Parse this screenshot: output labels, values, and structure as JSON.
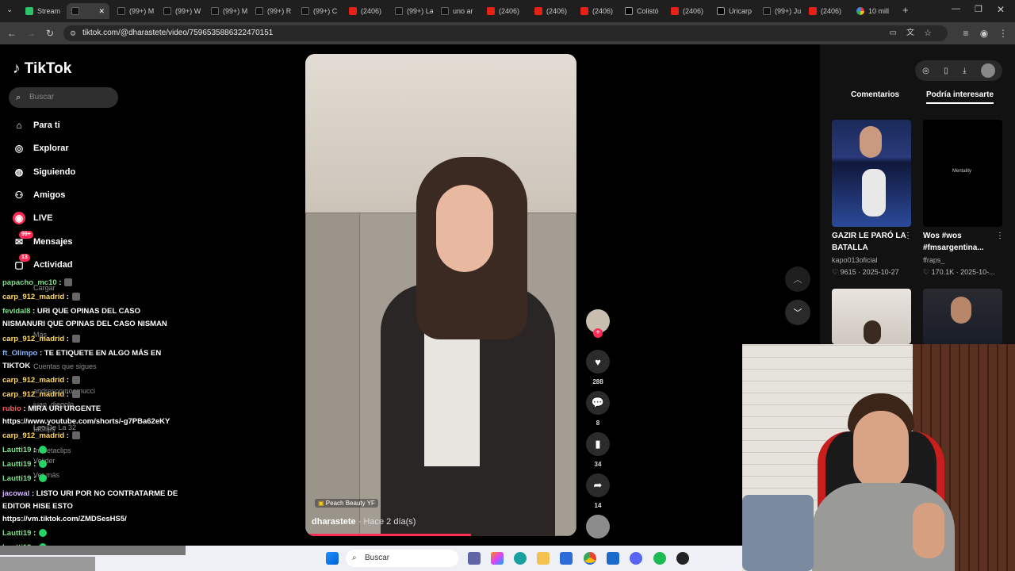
{
  "browser": {
    "tabs": [
      {
        "label": "Stream",
        "icon": "green-icon"
      },
      {
        "label": "",
        "icon": "tiktok-icon",
        "active": true
      },
      {
        "label": "(99+) M",
        "icon": "tiktok-icon"
      },
      {
        "label": "(99+) W",
        "icon": "tiktok-icon"
      },
      {
        "label": "(99+) M",
        "icon": "tiktok-icon"
      },
      {
        "label": "(99+) R",
        "icon": "tiktok-icon"
      },
      {
        "label": "(99+) C",
        "icon": "tiktok-icon"
      },
      {
        "label": "(2406)",
        "icon": "youtube-icon"
      },
      {
        "label": "(99+) La",
        "icon": "tiktok-icon"
      },
      {
        "label": "uno ar",
        "icon": "tiktok-icon"
      },
      {
        "label": "(2406)",
        "icon": "youtube-icon"
      },
      {
        "label": "(2406)",
        "icon": "youtube-icon"
      },
      {
        "label": "(2406)",
        "icon": "youtube-icon"
      },
      {
        "label": "Colistó",
        "icon": "x-icon"
      },
      {
        "label": "(2406)",
        "icon": "youtube-icon"
      },
      {
        "label": "Uricarp",
        "icon": "x-icon"
      },
      {
        "label": "(99+) Ju",
        "icon": "tiktok-icon"
      },
      {
        "label": "(2406)",
        "icon": "youtube-icon"
      },
      {
        "label": "10 mill",
        "icon": "google-icon"
      }
    ],
    "url": "tiktok.com/@dharastete/video/7596535886322470151"
  },
  "sidebar": {
    "logo": "TikTok",
    "search_placeholder": "Buscar",
    "items": [
      {
        "label": "Para ti",
        "icon": "home-icon"
      },
      {
        "label": "Explorar",
        "icon": "compass-icon"
      },
      {
        "label": "Siguiendo",
        "icon": "following-icon"
      },
      {
        "label": "Amigos",
        "icon": "friends-icon"
      },
      {
        "label": "LIVE",
        "icon": "live-icon"
      },
      {
        "label": "Mensajes",
        "icon": "messages-icon",
        "badge": "99+"
      },
      {
        "label": "Actividad",
        "icon": "activity-icon",
        "badge": "13"
      }
    ],
    "ghost_items": [
      "Cargar",
      "Más",
      "Cuentas que sigues",
      "andrescomoamucci",
      "juan_diegolo",
      "Leo De La 32",
      "taClips",
      "macetaclips",
      "Veijder",
      "Ver más"
    ]
  },
  "video": {
    "music_tag": "Peach Beauty YF",
    "author": "dharastete",
    "time": "· Hace 2 día(s)",
    "progress": 0.61
  },
  "actions": {
    "likes": "288",
    "comments": "8",
    "saves": "34",
    "shares": "14"
  },
  "right_panel": {
    "tabs": [
      "Comentarios",
      "Podría interesarte"
    ],
    "cards": [
      {
        "caption": "GAZIR LE PARÓ LA BATALLA",
        "user": "kapo013oficial",
        "likes": "9615",
        "date": "2025-10-27"
      },
      {
        "caption": "Wos #wos #fmsargentina...",
        "user": "ffraps_",
        "likes": "170.1K",
        "date": "2025-10-...",
        "thumb_text": "Mentality"
      }
    ]
  },
  "chat": [
    {
      "user": "papacho_mc10",
      "msg": " :",
      "color": "g"
    },
    {
      "user": "carp_912_madrid",
      "msg": " :",
      "color": "y"
    },
    {
      "user": "fevidal8",
      "msg": " : URI QUE OPINAS DEL CASO",
      "color": "g"
    },
    {
      "user": "",
      "msg": "NISMANURI QUE OPINAS DEL CASO NISMAN",
      "color": "y"
    },
    {
      "user": "carp_912_madrid",
      "msg": " :",
      "color": "y"
    },
    {
      "user": "ft_Olimpo",
      "msg": " : TE ETIQUETE EN ALGO MÁS EN",
      "color": "b"
    },
    {
      "user": "",
      "msg": "TIKTOK",
      "color": "y"
    },
    {
      "user": "carp_912_madrid",
      "msg": " :",
      "color": "y"
    },
    {
      "user": "carp_912_madrid",
      "msg": " :",
      "color": "y"
    },
    {
      "user": "rubio",
      "msg": " : MIRA URI URGENTE",
      "color": "r"
    },
    {
      "user": "",
      "msg": "https://www.youtube.com/shorts/-g7PBa62eKY",
      "color": "y"
    },
    {
      "user": "carp_912_madrid",
      "msg": " :",
      "color": "y"
    },
    {
      "user": "Lautti19",
      "msg": " :",
      "color": "g"
    },
    {
      "user": "Lautti19",
      "msg": " :",
      "color": "g"
    },
    {
      "user": "Lautti19",
      "msg": " :",
      "color": "g"
    },
    {
      "user": "jacowal",
      "msg": " : LISTO URI POR NO CONTRATARME DE",
      "color": "p"
    },
    {
      "user": "",
      "msg": "EDITOR HISE ESTO",
      "color": "y"
    },
    {
      "user": "",
      "msg": "https://vm.tiktok.com/ZMDSesHS5/",
      "color": "y"
    },
    {
      "user": "Lautti19",
      "msg": " :",
      "color": "g"
    },
    {
      "user": "Lautti19",
      "msg": " :",
      "color": "g"
    }
  ],
  "taskbar": {
    "search_label": "Buscar"
  }
}
